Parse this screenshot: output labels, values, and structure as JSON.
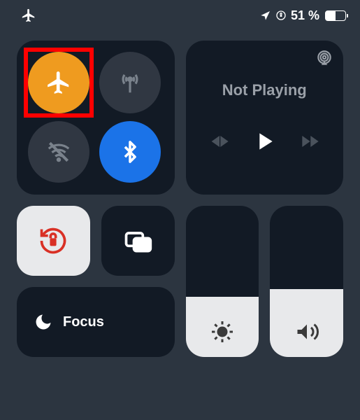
{
  "status_bar": {
    "battery_percent": "51 %"
  },
  "connectivity": {
    "airplane_enabled": true,
    "bluetooth_enabled": true
  },
  "media": {
    "title": "Not Playing"
  },
  "focus": {
    "label": "Focus"
  },
  "sliders": {
    "brightness_percent": 40,
    "volume_percent": 45
  }
}
